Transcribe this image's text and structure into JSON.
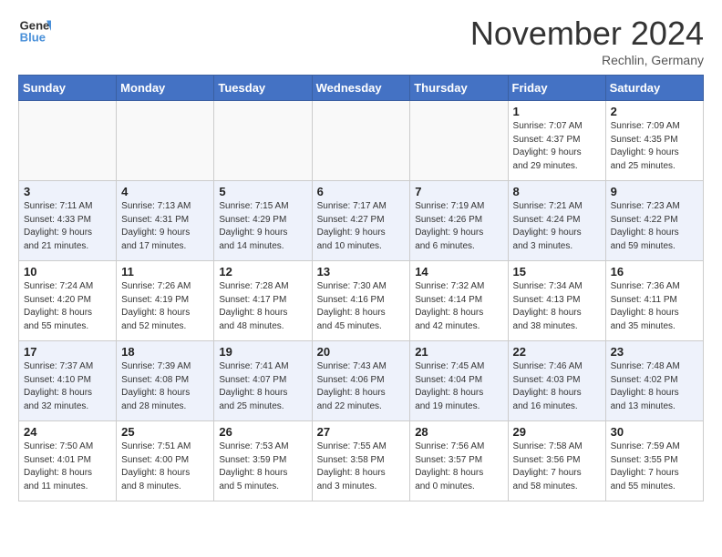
{
  "header": {
    "logo_line1": "General",
    "logo_line2": "Blue",
    "month": "November 2024",
    "location": "Rechlin, Germany"
  },
  "weekdays": [
    "Sunday",
    "Monday",
    "Tuesday",
    "Wednesday",
    "Thursday",
    "Friday",
    "Saturday"
  ],
  "weeks": [
    [
      {
        "day": "",
        "info": ""
      },
      {
        "day": "",
        "info": ""
      },
      {
        "day": "",
        "info": ""
      },
      {
        "day": "",
        "info": ""
      },
      {
        "day": "",
        "info": ""
      },
      {
        "day": "1",
        "info": "Sunrise: 7:07 AM\nSunset: 4:37 PM\nDaylight: 9 hours\nand 29 minutes."
      },
      {
        "day": "2",
        "info": "Sunrise: 7:09 AM\nSunset: 4:35 PM\nDaylight: 9 hours\nand 25 minutes."
      }
    ],
    [
      {
        "day": "3",
        "info": "Sunrise: 7:11 AM\nSunset: 4:33 PM\nDaylight: 9 hours\nand 21 minutes."
      },
      {
        "day": "4",
        "info": "Sunrise: 7:13 AM\nSunset: 4:31 PM\nDaylight: 9 hours\nand 17 minutes."
      },
      {
        "day": "5",
        "info": "Sunrise: 7:15 AM\nSunset: 4:29 PM\nDaylight: 9 hours\nand 14 minutes."
      },
      {
        "day": "6",
        "info": "Sunrise: 7:17 AM\nSunset: 4:27 PM\nDaylight: 9 hours\nand 10 minutes."
      },
      {
        "day": "7",
        "info": "Sunrise: 7:19 AM\nSunset: 4:26 PM\nDaylight: 9 hours\nand 6 minutes."
      },
      {
        "day": "8",
        "info": "Sunrise: 7:21 AM\nSunset: 4:24 PM\nDaylight: 9 hours\nand 3 minutes."
      },
      {
        "day": "9",
        "info": "Sunrise: 7:23 AM\nSunset: 4:22 PM\nDaylight: 8 hours\nand 59 minutes."
      }
    ],
    [
      {
        "day": "10",
        "info": "Sunrise: 7:24 AM\nSunset: 4:20 PM\nDaylight: 8 hours\nand 55 minutes."
      },
      {
        "day": "11",
        "info": "Sunrise: 7:26 AM\nSunset: 4:19 PM\nDaylight: 8 hours\nand 52 minutes."
      },
      {
        "day": "12",
        "info": "Sunrise: 7:28 AM\nSunset: 4:17 PM\nDaylight: 8 hours\nand 48 minutes."
      },
      {
        "day": "13",
        "info": "Sunrise: 7:30 AM\nSunset: 4:16 PM\nDaylight: 8 hours\nand 45 minutes."
      },
      {
        "day": "14",
        "info": "Sunrise: 7:32 AM\nSunset: 4:14 PM\nDaylight: 8 hours\nand 42 minutes."
      },
      {
        "day": "15",
        "info": "Sunrise: 7:34 AM\nSunset: 4:13 PM\nDaylight: 8 hours\nand 38 minutes."
      },
      {
        "day": "16",
        "info": "Sunrise: 7:36 AM\nSunset: 4:11 PM\nDaylight: 8 hours\nand 35 minutes."
      }
    ],
    [
      {
        "day": "17",
        "info": "Sunrise: 7:37 AM\nSunset: 4:10 PM\nDaylight: 8 hours\nand 32 minutes."
      },
      {
        "day": "18",
        "info": "Sunrise: 7:39 AM\nSunset: 4:08 PM\nDaylight: 8 hours\nand 28 minutes."
      },
      {
        "day": "19",
        "info": "Sunrise: 7:41 AM\nSunset: 4:07 PM\nDaylight: 8 hours\nand 25 minutes."
      },
      {
        "day": "20",
        "info": "Sunrise: 7:43 AM\nSunset: 4:06 PM\nDaylight: 8 hours\nand 22 minutes."
      },
      {
        "day": "21",
        "info": "Sunrise: 7:45 AM\nSunset: 4:04 PM\nDaylight: 8 hours\nand 19 minutes."
      },
      {
        "day": "22",
        "info": "Sunrise: 7:46 AM\nSunset: 4:03 PM\nDaylight: 8 hours\nand 16 minutes."
      },
      {
        "day": "23",
        "info": "Sunrise: 7:48 AM\nSunset: 4:02 PM\nDaylight: 8 hours\nand 13 minutes."
      }
    ],
    [
      {
        "day": "24",
        "info": "Sunrise: 7:50 AM\nSunset: 4:01 PM\nDaylight: 8 hours\nand 11 minutes."
      },
      {
        "day": "25",
        "info": "Sunrise: 7:51 AM\nSunset: 4:00 PM\nDaylight: 8 hours\nand 8 minutes."
      },
      {
        "day": "26",
        "info": "Sunrise: 7:53 AM\nSunset: 3:59 PM\nDaylight: 8 hours\nand 5 minutes."
      },
      {
        "day": "27",
        "info": "Sunrise: 7:55 AM\nSunset: 3:58 PM\nDaylight: 8 hours\nand 3 minutes."
      },
      {
        "day": "28",
        "info": "Sunrise: 7:56 AM\nSunset: 3:57 PM\nDaylight: 8 hours\nand 0 minutes."
      },
      {
        "day": "29",
        "info": "Sunrise: 7:58 AM\nSunset: 3:56 PM\nDaylight: 7 hours\nand 58 minutes."
      },
      {
        "day": "30",
        "info": "Sunrise: 7:59 AM\nSunset: 3:55 PM\nDaylight: 7 hours\nand 55 minutes."
      }
    ]
  ]
}
